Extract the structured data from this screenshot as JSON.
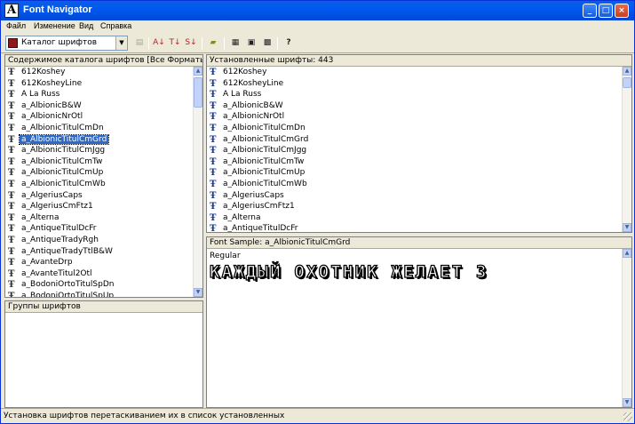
{
  "window": {
    "title": "Font Navigator",
    "controls": {
      "minimize": "_",
      "maximize": "□",
      "close": "×"
    }
  },
  "menu": [
    "Файл",
    "Изменение",
    "Вид",
    "Справка"
  ],
  "toolbar": {
    "catalog_combo": "Каталог шрифтов",
    "tools": [
      {
        "name": "properties-icon",
        "glyph": "▤"
      },
      {
        "name": "sort-az-icon",
        "glyph": "A↓"
      },
      {
        "name": "sort-type-icon",
        "glyph": "T↓"
      },
      {
        "name": "sort-size-icon",
        "glyph": "S↓"
      },
      {
        "name": "new-folder-icon",
        "glyph": "▰"
      },
      {
        "name": "print-icon",
        "glyph": "▦"
      },
      {
        "name": "preview-icon",
        "glyph": "▣"
      },
      {
        "name": "install-icon",
        "glyph": "▩"
      },
      {
        "name": "help-icon",
        "glyph": "?"
      }
    ]
  },
  "catalog_panel": {
    "header": "Содержимое каталога шрифтов   [Все Форматы, Все ...",
    "selected_index": 6,
    "items": [
      "612Koshey",
      "612KosheyLine",
      "A La Russ",
      "a_AlbionicB&W",
      "a_AlbionicNrOtl",
      "a_AlbionicTitulCmDn",
      "a_AlbionicTitulCmGrd",
      "a_AlbionicTitulCmJgg",
      "a_AlbionicTitulCmTw",
      "a_AlbionicTitulCmUp",
      "a_AlbionicTitulCmWb",
      "a_AlgeriusCaps",
      "a_AlgeriusCmFtz1",
      "a_Alterna",
      "a_AntiqueTitulDcFr",
      "a_AntiqueTradyRgh",
      "a_AntiqueTradyTtlB&W",
      "a_AvanteDrp",
      "a_AvanteTitul2Otl",
      "a_BodoniOrtoTitulSpDn",
      "a_BodoniOrtoTitulSpUp"
    ]
  },
  "groups_panel": {
    "header": "Группы шрифтов"
  },
  "installed_panel": {
    "header": "Установленные шрифты: 443",
    "items": [
      "612Koshey",
      "612KosheyLine",
      "A La Russ",
      "a_AlbionicB&W",
      "a_AlbionicNrOtl",
      "a_AlbionicTitulCmDn",
      "a_AlbionicTitulCmGrd",
      "a_AlbionicTitulCmJgg",
      "a_AlbionicTitulCmTw",
      "a_AlbionicTitulCmUp",
      "a_AlbionicTitulCmWb",
      "a_AlgeriusCaps",
      "a_AlgeriusCmFtz1",
      "a_Alterna",
      "a_AntiqueTitulDcFr"
    ]
  },
  "sample_panel": {
    "header": "Font Sample:   a_AlbionicTitulCmGrd",
    "style": "Regular",
    "text": "КАЖДЫЙ ОХОТНИК ЖЕЛАЕТ З"
  },
  "status": {
    "text": "Установка шрифтов перетаскиванием их в список установленных"
  },
  "colors": {
    "title_bar": "#0058ee",
    "selection": "#316ac5",
    "chrome": "#ece9d8"
  }
}
